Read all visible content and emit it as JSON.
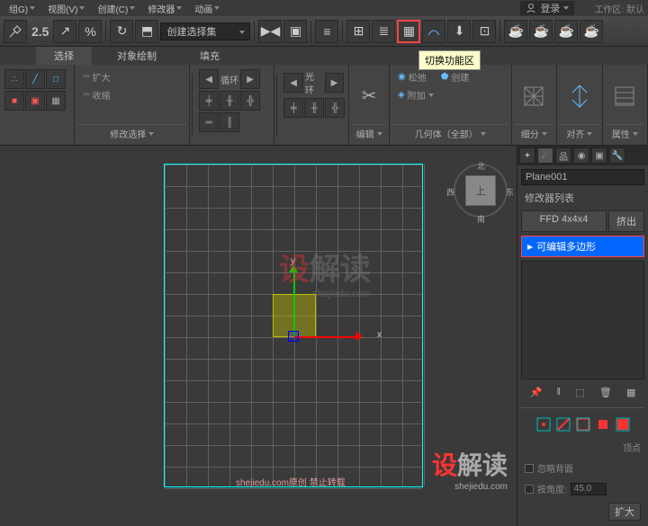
{
  "menubar": {
    "items": [
      "组G)",
      "视图(V)",
      "创建(C)",
      "修改器",
      "动画"
    ],
    "login": "登录",
    "workspace_label": "工作区: 默认"
  },
  "toolbar": {
    "scale_label": "2.5",
    "create_set": "创建选择集"
  },
  "tooltip": "切换功能区",
  "tabs": [
    "选择",
    "对象绘制",
    "填充"
  ],
  "ribbon": {
    "panel0_label": "修改选择",
    "expand": "扩大",
    "shrink": "收缩",
    "loop": "循环",
    "ring": "光环",
    "edit": "编辑",
    "relax": "松弛",
    "create": "创建",
    "attach": "附加",
    "geom_label": "几何体（全部）",
    "subdiv": "细分",
    "align": "对齐",
    "props": "属性"
  },
  "viewport": {
    "axis_x": "x",
    "axis_y": "y",
    "viewcube_top": "上",
    "compass_n": "北",
    "compass_s": "南",
    "compass_e": "东",
    "compass_w": "西",
    "watermark1_a": "设",
    "watermark1_b": "解读",
    "watermark1_url": "shejiedu.com",
    "watermark2": "shejiedu.com原创 禁止转载"
  },
  "side": {
    "object_name": "Plane001",
    "mod_list_label": "修改器列表",
    "ffd": "FFD 4x4x4",
    "extrude": "挤出",
    "editable_poly": "可编辑多边形",
    "vertex": "顶点",
    "ignore_back": "忽略背面",
    "by_angle": "按角度:",
    "angle_val": "45.0",
    "expand": "扩大"
  }
}
